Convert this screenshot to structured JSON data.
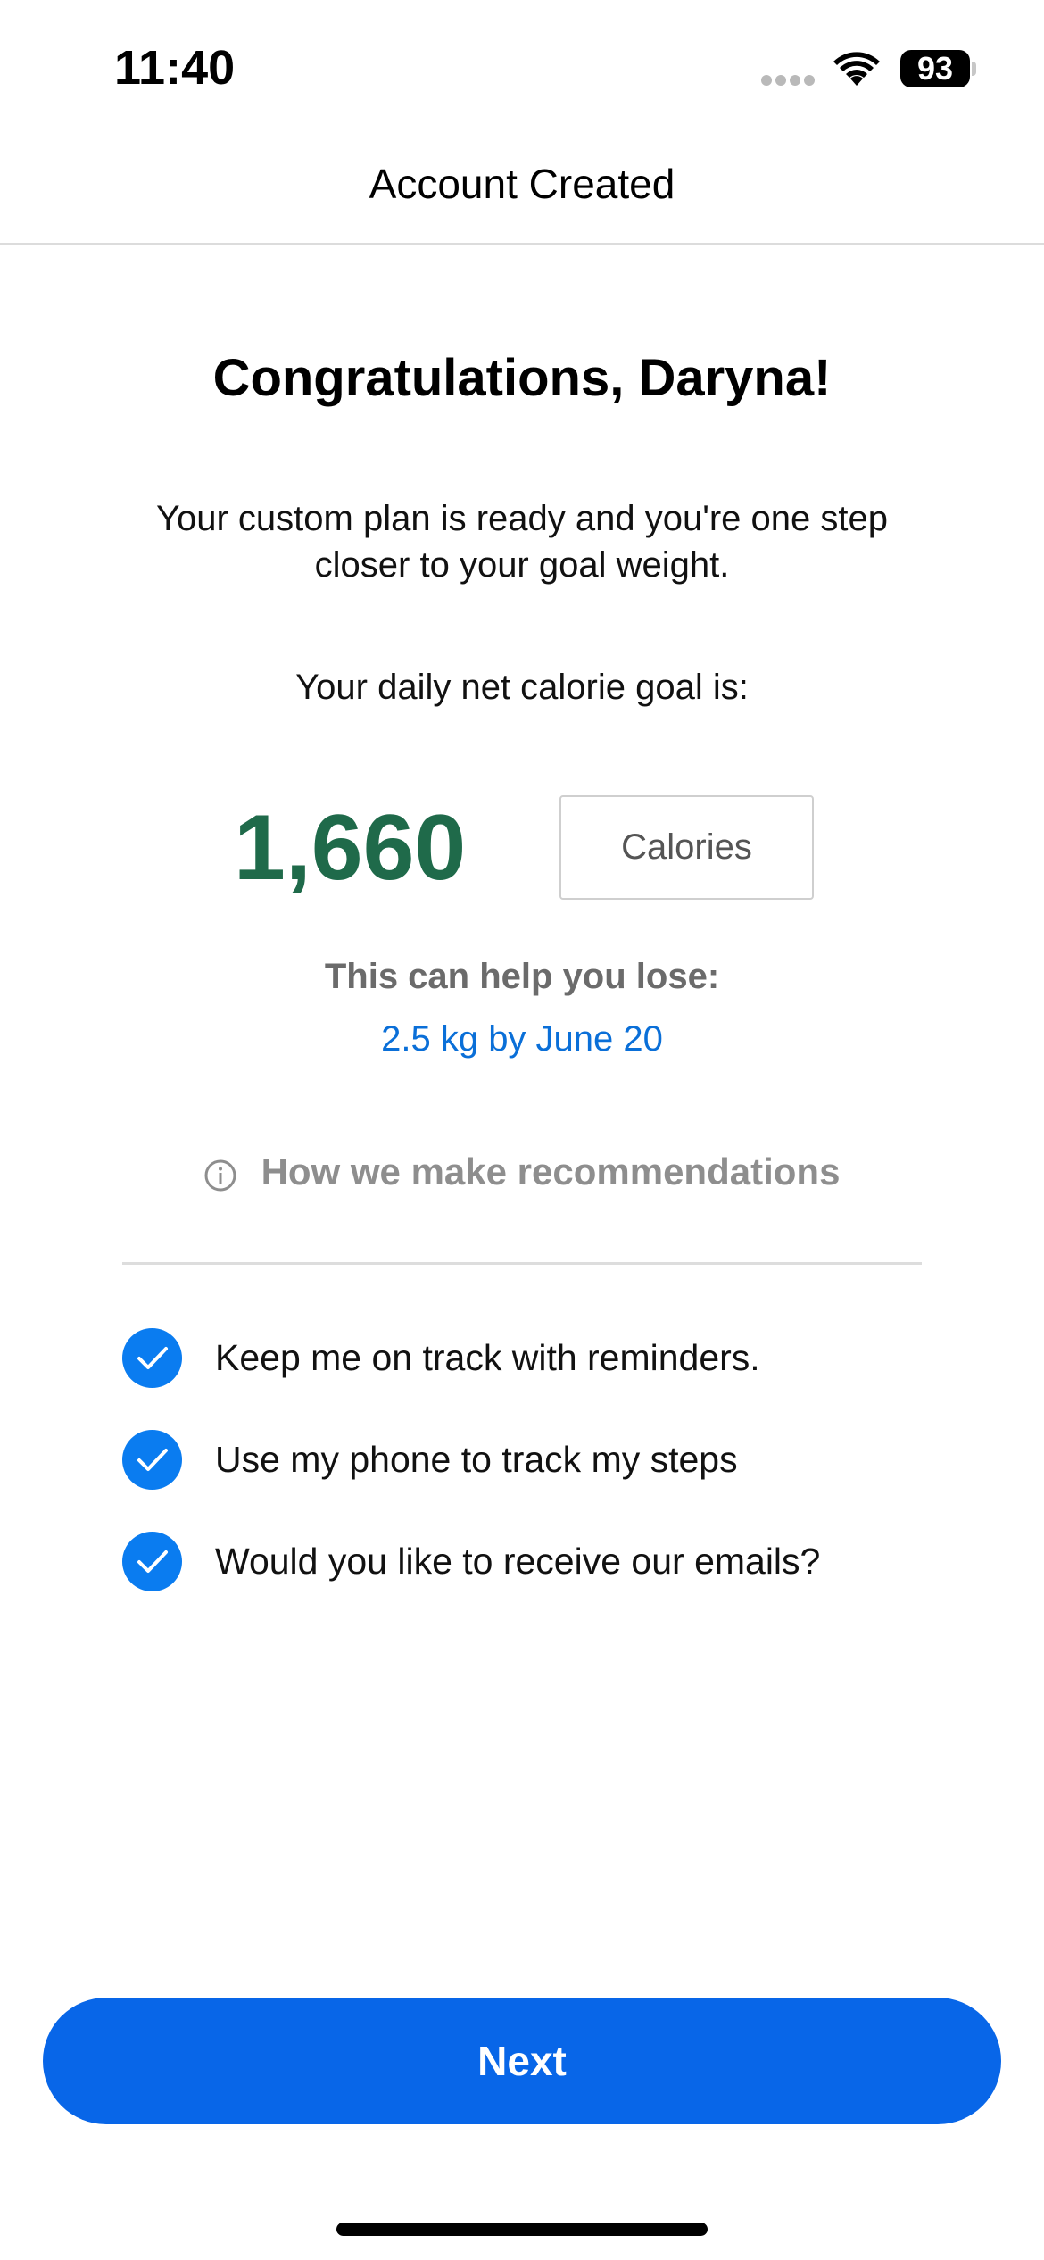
{
  "status_bar": {
    "time": "11:40",
    "battery_level": "93",
    "icons": [
      "signal-dots-icon",
      "wifi-icon",
      "battery-icon"
    ]
  },
  "nav": {
    "title": "Account Created"
  },
  "main": {
    "headline": "Congratulations, Daryna!",
    "subtext": "Your custom plan is ready and you're one step closer to your goal weight.",
    "goal_label": "Your daily net calorie goal is:",
    "calorie_value": "1,660",
    "unit_label": "Calories",
    "lose_label": "This can help you lose:",
    "lose_value": "2.5 kg by June 20",
    "recommend_link": "How we make recommendations"
  },
  "options": [
    {
      "label": "Keep me on track with reminders.",
      "checked": true
    },
    {
      "label": "Use my phone to track my steps",
      "checked": true
    },
    {
      "label": "Would you like to receive our emails?",
      "checked": true
    }
  ],
  "footer": {
    "next_label": "Next"
  },
  "colors": {
    "accent_blue": "#0866e8",
    "checkbox_blue": "#0a7cf0",
    "calorie_green": "#1f6a4a",
    "link_blue": "#0a6fd8",
    "muted_gray": "#8e8e8e"
  }
}
